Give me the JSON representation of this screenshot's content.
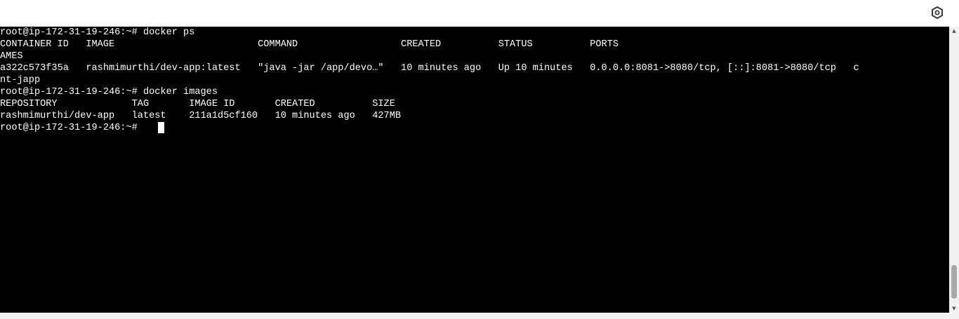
{
  "toolbar": {
    "settings_icon": "hexagon-settings-icon"
  },
  "terminal": {
    "lines": [
      "root@ip-172-31-19-246:~# docker ps",
      "CONTAINER ID   IMAGE                         COMMAND                  CREATED          STATUS          PORTS                                                                          N",
      "AMES",
      "a322c573f35a   rashmimurthi/dev-app:latest   \"java -jar /app/devo…\"   10 minutes ago   Up 10 minutes   0.0.0.0:8081->8080/tcp, [::]:8081->8080/tcp   c",
      "nt-japp",
      "root@ip-172-31-19-246:~# docker images",
      "REPOSITORY             TAG       IMAGE ID       CREATED          SIZE",
      "rashmimurthi/dev-app   latest    211a1d5cf160   10 minutes ago   427MB",
      "root@ip-172-31-19-246:~# "
    ]
  },
  "colors": {
    "terminal_bg": "#000000",
    "terminal_fg": "#ffffff",
    "scrollbar_thumb": "#a8a8a8"
  }
}
